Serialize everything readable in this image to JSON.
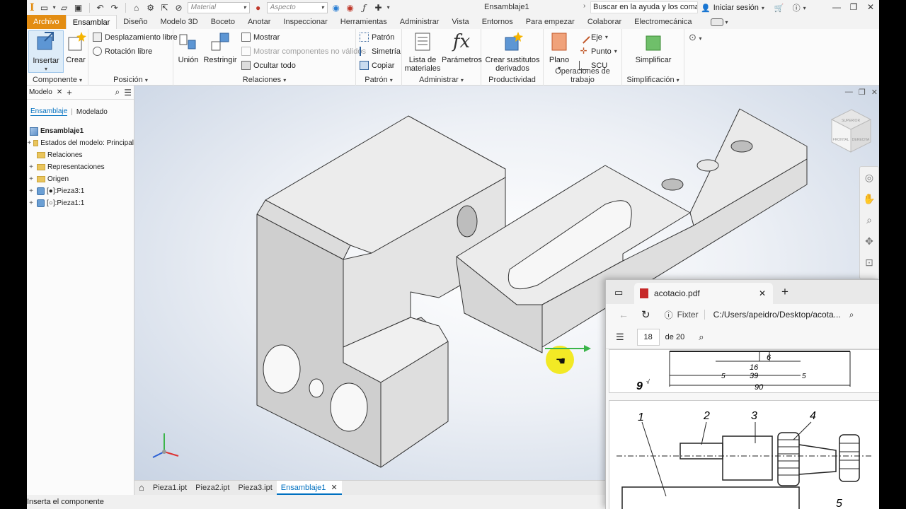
{
  "titlebar": {
    "material_placeholder": "Material",
    "appearance_placeholder": "Aspecto",
    "document_title": "Ensamblaje1",
    "search_help": "Buscar en la ayuda y los comand",
    "sign_in": "Iniciar sesión"
  },
  "tabs": [
    "Archivo",
    "Ensamblar",
    "Diseño",
    "Modelo 3D",
    "Boceto",
    "Anotar",
    "Inspeccionar",
    "Herramientas",
    "Administrar",
    "Vista",
    "Entornos",
    "Para empezar",
    "Colaborar",
    "Electromecánica"
  ],
  "ribbon": {
    "componente": {
      "title": "Componente",
      "insertar": "Insertar",
      "crear": "Crear"
    },
    "posicion": {
      "title": "Posición",
      "desplazamiento": "Desplazamiento libre",
      "rotacion": "Rotación libre"
    },
    "relaciones": {
      "title": "Relaciones",
      "union": "Unión",
      "restringir": "Restringir",
      "mostrar": "Mostrar",
      "mostrar_no_validos": "Mostrar componentes no válidos",
      "ocultar_todo": "Ocultar todo"
    },
    "patron": {
      "title": "Patrón",
      "patron": "Patrón",
      "simetria": "Simetría",
      "copiar": "Copiar"
    },
    "administrar": {
      "title": "Administrar",
      "lista_materiales_1": "Lista de",
      "lista_materiales_2": "materiales",
      "parametros": "Parámetros"
    },
    "productividad": {
      "title": "Productividad",
      "crear_sustitutos_1": "Crear sustitutos",
      "crear_sustitutos_2": "derivados"
    },
    "operaciones": {
      "title": "Operaciones de trabajo",
      "plano": "Plano",
      "eje": "Eje",
      "punto": "Punto",
      "scu": "SCU"
    },
    "simplificacion": {
      "title": "Simplificación",
      "simplificar": "Simplificar"
    }
  },
  "browser": {
    "title": "Modelo",
    "tab_ensamblaje": "Ensamblaje",
    "tab_modelado": "Modelado",
    "root": "Ensamblaje1",
    "items": [
      {
        "label": "Estados del modelo: Principal",
        "type": "folder"
      },
      {
        "label": "Relaciones",
        "type": "folder"
      },
      {
        "label": "Representaciones",
        "type": "folder"
      },
      {
        "label": "Origen",
        "type": "folder"
      },
      {
        "label": "[●]:Pieza3:1",
        "type": "part"
      },
      {
        "label": "[○]:Pieza1:1",
        "type": "part"
      }
    ]
  },
  "viewcube": {
    "top": "SUPERIOR",
    "front": "FRONTAL",
    "right": "DERECHA"
  },
  "doctabs": [
    "Pieza1.ipt",
    "Pieza2.ipt",
    "Pieza3.ipt",
    "Ensamblaje1"
  ],
  "status": "Inserta el componente",
  "pdf": {
    "tab_title": "acotacio.pdf",
    "fix_label": "Fixter",
    "path": "C:/Users/apeidro/Desktop/acota...",
    "page": "18",
    "of_pages": "de 20",
    "dims": {
      "d16": "16",
      "d39": "39",
      "d90": "90",
      "d5a": "5",
      "d5b": "5",
      "d6": "6",
      "finish": "9"
    },
    "callouts": [
      "1",
      "2",
      "3",
      "4",
      "5"
    ]
  },
  "colors": {
    "file_tab": "#e38d13",
    "accent": "#0070c0",
    "cursor_highlight": "#f2e600"
  }
}
